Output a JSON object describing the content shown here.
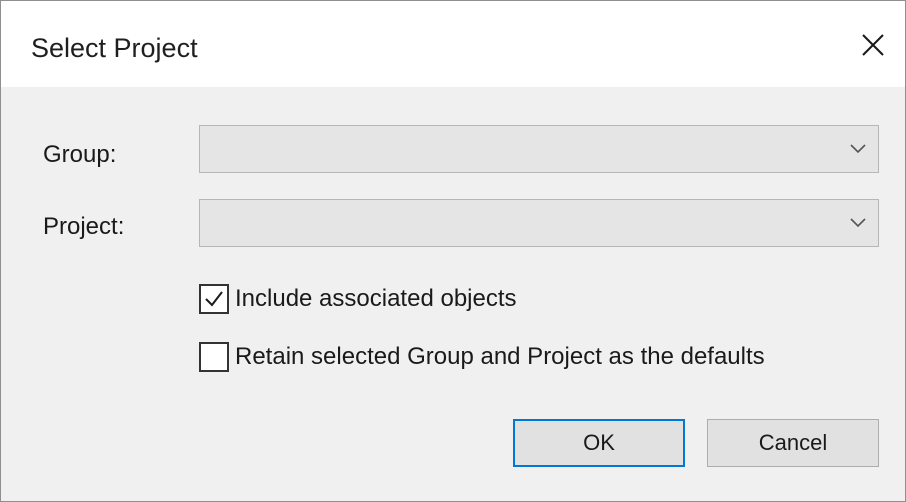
{
  "dialog": {
    "title": "Select Project",
    "close_icon": "close-icon"
  },
  "fields": {
    "group": {
      "label": "Group:",
      "value": "",
      "arrow_icon": "chevron-down-icon"
    },
    "project": {
      "label": "Project:",
      "value": "",
      "arrow_icon": "chevron-down-icon"
    }
  },
  "options": {
    "include_associated": {
      "label": "Include associated objects",
      "checked": true
    },
    "retain_defaults": {
      "label": "Retain selected Group and Project as the defaults",
      "checked": false
    }
  },
  "buttons": {
    "ok_label": "OK",
    "cancel_label": "Cancel"
  },
  "colors": {
    "dialog_background": "#f0f0f0",
    "titlebar_background": "#ffffff",
    "combo_background": "#e5e5e5",
    "default_button_border": "#0078d7"
  }
}
